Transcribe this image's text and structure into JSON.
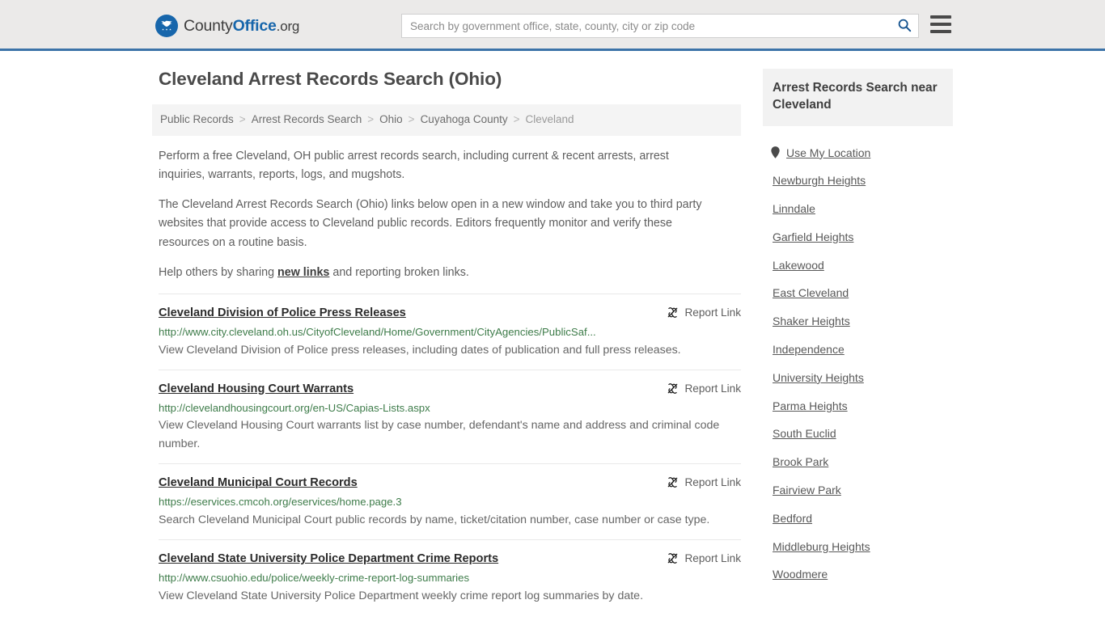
{
  "header": {
    "brand": {
      "part1": "County",
      "part2": "Office",
      "part3": ".org",
      "logo_icon": "eagle-seal-icon"
    },
    "search": {
      "placeholder": "Search by government office, state, county, city or zip code",
      "value": "",
      "icon": "search-icon"
    },
    "menu_icon": "hamburger-menu-icon",
    "accent_color": "#3c73a8",
    "background_color": "#ebeae9"
  },
  "page": {
    "title": "Cleveland Arrest Records Search (Ohio)"
  },
  "breadcrumb": [
    {
      "label": "Public Records",
      "current": false
    },
    {
      "label": "Arrest Records Search",
      "current": false
    },
    {
      "label": "Ohio",
      "current": false
    },
    {
      "label": "Cuyahoga County",
      "current": false
    },
    {
      "label": "Cleveland",
      "current": true
    }
  ],
  "breadcrumb_separator": ">",
  "intro": {
    "p1": "Perform a free Cleveland, OH public arrest records search, including current & recent arrests, arrest inquiries, warrants, reports, logs, and mugshots.",
    "p2": "The Cleveland Arrest Records Search (Ohio) links below open in a new window and take you to third party websites that provide access to Cleveland public records. Editors frequently monitor and verify these resources on a routine basis.",
    "p3_before": "Help others by sharing ",
    "p3_link": "new links",
    "p3_after": " and reporting broken links."
  },
  "report_link_label": "Report Link",
  "report_link_icon": "broken-link-icon",
  "results": [
    {
      "title": "Cleveland Division of Police Press Releases",
      "url": "http://www.city.cleveland.oh.us/CityofCleveland/Home/Government/CityAgencies/PublicSaf...",
      "description": "View Cleveland Division of Police press releases, including dates of publication and full press releases."
    },
    {
      "title": "Cleveland Housing Court Warrants",
      "url": "http://clevelandhousingcourt.org/en-US/Capias-Lists.aspx",
      "description": "View Cleveland Housing Court warrants list by case number, defendant's name and address and criminal code number."
    },
    {
      "title": "Cleveland Municipal Court Records",
      "url": "https://eservices.cmcoh.org/eservices/home.page.3",
      "description": "Search Cleveland Municipal Court public records by name, ticket/citation number, case number or case type."
    },
    {
      "title": "Cleveland State University Police Department Crime Reports",
      "url": "http://www.csuohio.edu/police/weekly-crime-report-log-summaries",
      "description": "View Cleveland State University Police Department weekly crime report log summaries by date."
    }
  ],
  "sidebar": {
    "heading": "Arrest Records Search near Cleveland",
    "use_my_location": {
      "label": "Use My Location",
      "icon": "map-pin-icon"
    },
    "nearby": [
      "Newburgh Heights",
      "Linndale",
      "Garfield Heights",
      "Lakewood",
      "East Cleveland",
      "Shaker Heights",
      "Independence",
      "University Heights",
      "Parma Heights",
      "South Euclid",
      "Brook Park",
      "Fairview Park",
      "Bedford",
      "Middleburg Heights",
      "Woodmere"
    ]
  },
  "colors": {
    "url_green": "#3e7c4a",
    "link_gray": "#585858",
    "header_blue": "#3c73a8"
  }
}
